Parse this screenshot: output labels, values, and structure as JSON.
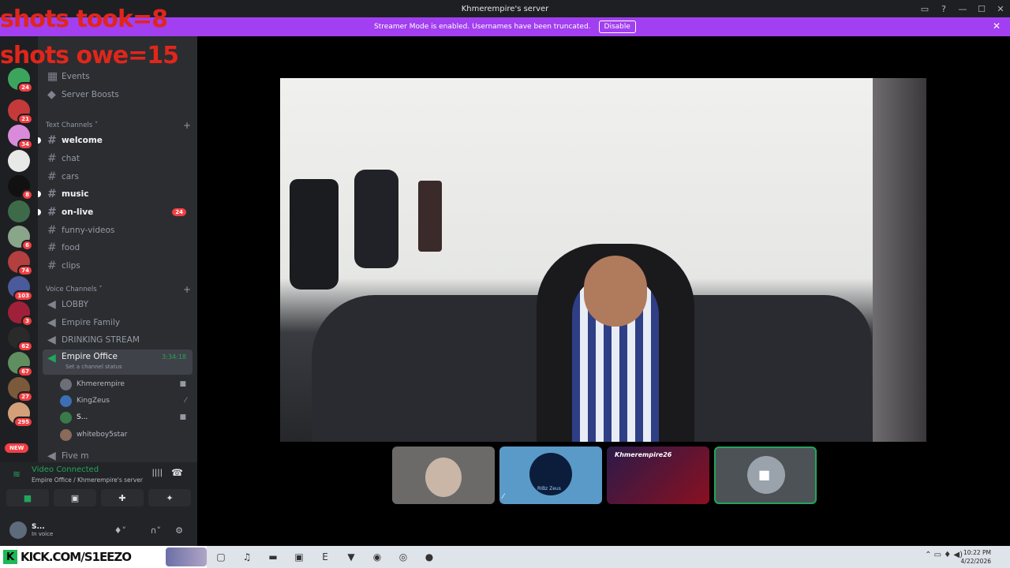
{
  "window": {
    "title": "Khmerempire's server"
  },
  "banner": {
    "text": "Streamer Mode is enabled. Usernames have been truncated.",
    "disable_label": "Disable"
  },
  "overlay": {
    "line1": "shots took=8",
    "line2": "shots owe=15"
  },
  "server": {
    "name": "Khmerempire's server"
  },
  "guild_badges": [
    "16",
    "24",
    "21",
    "34",
    "8",
    "6",
    "74",
    "103",
    "3",
    "62",
    "67",
    "27",
    "295"
  ],
  "guild_new": "NEW",
  "sidebar": {
    "top_items": [
      "Events",
      "Server Boosts"
    ],
    "text_category": "Text Channels",
    "text_channels": [
      {
        "name": "welcome",
        "bold": true
      },
      {
        "name": "chat",
        "bold": false
      },
      {
        "name": "cars",
        "bold": false
      },
      {
        "name": "music",
        "bold": true
      },
      {
        "name": "on-live",
        "bold": true,
        "badge": "24"
      },
      {
        "name": "funny-videos",
        "bold": false
      },
      {
        "name": "food",
        "bold": false
      },
      {
        "name": "clips",
        "bold": false
      }
    ],
    "voice_category": "Voice Channels",
    "voice_channels": [
      "LOBBY",
      "Empire Family",
      "DRINKING STREAM"
    ],
    "active_voice": {
      "name": "Empire Office",
      "timer": "3:34:18",
      "status": "Set a channel status"
    },
    "voice_users": [
      "Khmerempire",
      "KingZeus",
      "S...",
      "whiteboy5star"
    ],
    "more_channel": "Five m"
  },
  "panel": {
    "connection": "Video Connected",
    "location": "Empire Office / Khmerempire's server",
    "user_name": "S...",
    "user_status": "In voice"
  },
  "thumbs": {
    "zeus_label": "RIBz Zeus",
    "khmer_label": "Khmerempire26"
  },
  "taskbar": {
    "kick_text": "KICK.COM/S1EEZO",
    "time": "10:22 PM",
    "date": "4/22/2026"
  }
}
